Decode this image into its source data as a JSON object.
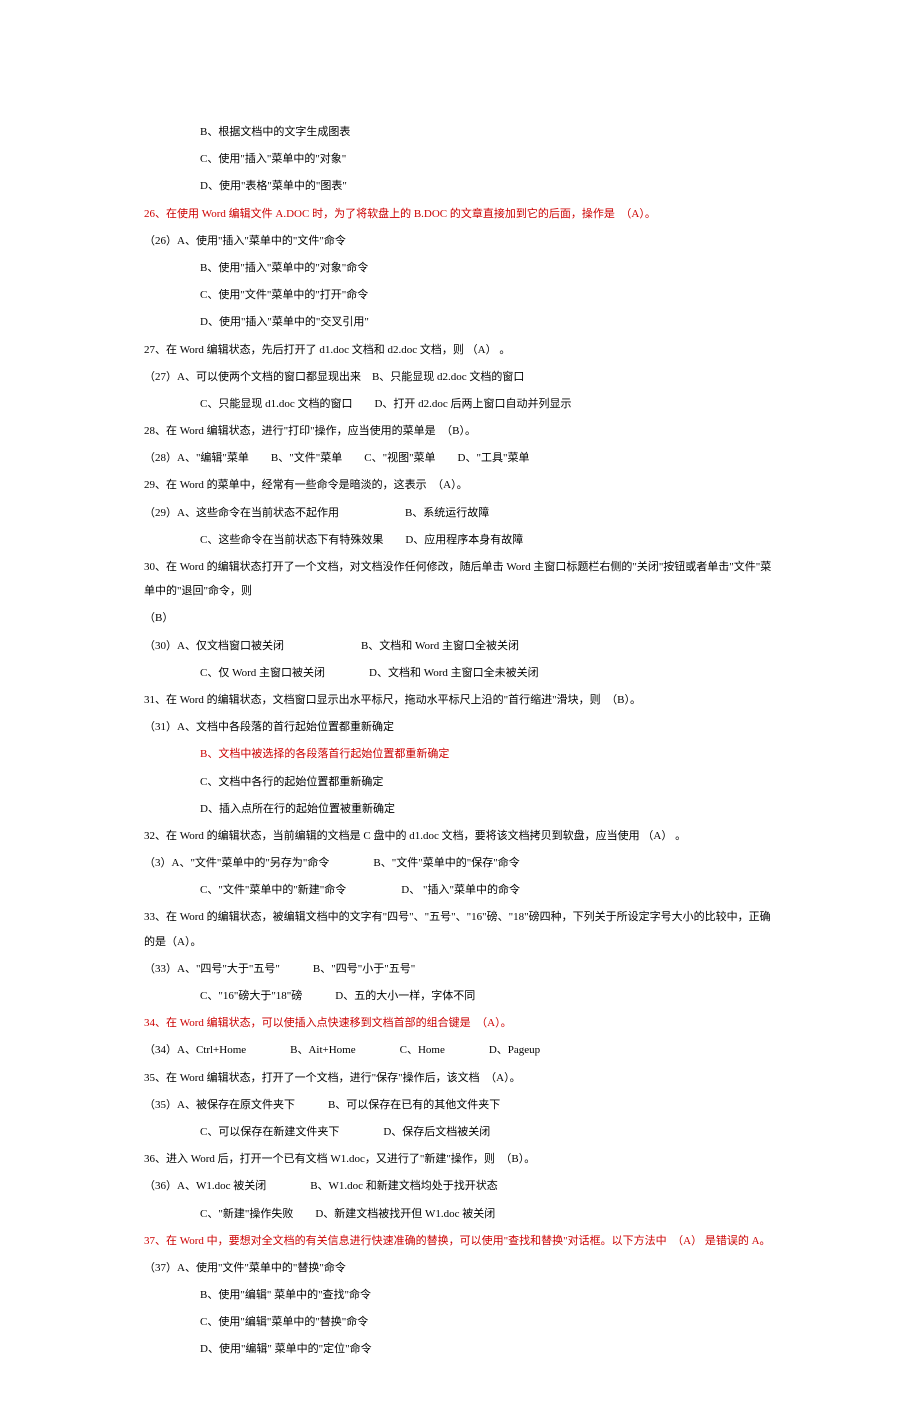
{
  "lines": [
    {
      "cls": "indent1",
      "red": false,
      "text": "B、根据文档中的文字生成图表"
    },
    {
      "cls": "indent1",
      "red": false,
      "text": "C、使用\"插入\"菜单中的\"对象\""
    },
    {
      "cls": "indent1",
      "red": false,
      "text": "D、使用\"表格\"菜单中的\"图表\""
    },
    {
      "cls": "indent0",
      "red": true,
      "text": "26、在使用 Word 编辑文件 A.DOC 时，为了将软盘上的 B.DOC 的文章直接加到它的后面，操作是　（A）。"
    },
    {
      "cls": "indent0",
      "red": false,
      "text": "（26）A、使用\"插入\"菜单中的\"文件\"命令"
    },
    {
      "cls": "indent1",
      "red": false,
      "text": "B、使用\"插入\"菜单中的\"对象\"命令"
    },
    {
      "cls": "indent1",
      "red": false,
      "text": "C、使用\"文件\"菜单中的\"打开\"命令"
    },
    {
      "cls": "indent1",
      "red": false,
      "text": "D、使用\"插入\"菜单中的\"交叉引用\""
    },
    {
      "cls": "indent0",
      "red": false,
      "text": "27、在 Word 编辑状态，先后打开了 d1.doc 文档和 d2.doc 文档，则 （A） 。"
    },
    {
      "cls": "indent0",
      "red": false,
      "text": "（27）A、可以使两个文档的窗口都显现出来　B、只能显现 d2.doc 文档的窗口"
    },
    {
      "cls": "indent1",
      "red": false,
      "text": "C、只能显现 d1.doc 文档的窗口　　D、打开 d2.doc 后两上窗口自动并列显示"
    },
    {
      "cls": "indent0",
      "red": false,
      "text": "28、在 Word 编辑状态，进行\"打印\"操作，应当使用的菜单是　（B）。"
    },
    {
      "cls": "indent0",
      "red": false,
      "text": "（28）A、\"编辑\"菜单　　B、\"文件\"菜单　　C、\"视图\"菜单　　D、\"工具\"菜单"
    },
    {
      "cls": "indent0",
      "red": false,
      "text": "29、在 Word 的菜单中，经常有一些命令是暗淡的，这表示　（A）。"
    },
    {
      "cls": "indent0",
      "red": false,
      "text": "（29）A、这些命令在当前状态不起作用　　　　　　B、系统运行故障"
    },
    {
      "cls": "indent1",
      "red": false,
      "text": "C、这些命令在当前状态下有特殊效果　　D、应用程序本身有故障"
    },
    {
      "cls": "indent0",
      "red": false,
      "text": "30、在 Word 的编辑状态打开了一个文档，对文档没作任何修改，随后单击 Word 主窗口标题栏右侧的\"关闭\"按钮或者单击\"文件\"菜单中的\"退回\"命令，则"
    },
    {
      "cls": "indent0",
      "red": false,
      "text": "（B）"
    },
    {
      "cls": "indent0",
      "red": false,
      "text": "（30）A、仅文档窗口被关闭　　　　　　　B、文档和 Word 主窗口全被关闭"
    },
    {
      "cls": "indent1",
      "red": false,
      "text": "C、仅 Word 主窗口被关闭　　　　D、文档和 Word 主窗口全未被关闭"
    },
    {
      "cls": "indent0",
      "red": false,
      "text": "31、在 Word 的编辑状态，文档窗口显示出水平标尺，拖动水平标尺上沿的\"首行缩进\"滑块，则　（B）。"
    },
    {
      "cls": "indent0",
      "red": false,
      "text": "（31）A、文档中各段落的首行起始位置都重新确定"
    },
    {
      "cls": "indent1",
      "red": true,
      "text": "B、文档中被选择的各段落首行起始位置都重新确定"
    },
    {
      "cls": "indent1",
      "red": false,
      "text": "C、文档中各行的起始位置都重新确定"
    },
    {
      "cls": "indent1",
      "red": false,
      "text": "D、插入点所在行的起始位置被重新确定"
    },
    {
      "cls": "indent0",
      "red": false,
      "text": "32、在 Word 的编辑状态，当前编辑的文档是 C 盘中的 d1.doc 文档，要将该文档拷贝到软盘，应当使用 （A） 。"
    },
    {
      "cls": "indent0",
      "red": false,
      "text": "（3）A、\"文件\"菜单中的\"另存为\"命令　　　　B、\"文件\"菜单中的\"保存\"命令"
    },
    {
      "cls": "indent1",
      "red": false,
      "text": "C、\"文件\"菜单中的\"新建\"命令　　　　　D、 \"插入\"菜单中的命令"
    },
    {
      "cls": "indent0",
      "red": false,
      "text": "33、在 Word 的编辑状态，被编辑文档中的文字有\"四号\"、\"五号\"、\"16\"磅、\"18\"磅四种，下列关于所设定字号大小的比较中，正确的是（A）。"
    },
    {
      "cls": "indent0",
      "red": false,
      "text": "（33）A、\"四号\"大于\"五号\"　　　B、\"四号\"小于\"五号\""
    },
    {
      "cls": "indent1",
      "red": false,
      "text": "C、\"16\"磅大于\"18\"磅　　　D、五的大小一样，字体不同"
    },
    {
      "cls": "indent0",
      "red": true,
      "text": "34、在 Word 编辑状态，可以使插入点快速移到文档首部的组合键是　（A）。"
    },
    {
      "cls": "indent0",
      "red": false,
      "text": "（34）A、Ctrl+Home　　　　B、Ait+Home　　　　C、Home　　　　D、Pageup"
    },
    {
      "cls": "indent0",
      "red": false,
      "text": "35、在 Word 编辑状态，打开了一个文档，进行\"保存\"操作后，该文档　（A）。"
    },
    {
      "cls": "indent0",
      "red": false,
      "text": "（35）A、被保存在原文件夹下　　　B、可以保存在已有的其他文件夹下"
    },
    {
      "cls": "indent1",
      "red": false,
      "text": "C、可以保存在新建文件夹下　　　　D、保存后文档被关闭"
    },
    {
      "cls": "indent0",
      "red": false,
      "text": "36、进入 Word 后，打开一个已有文档 W1.doc，又进行了\"新建\"操作，则　（B）。"
    },
    {
      "cls": "indent0",
      "red": false,
      "text": "（36）A、W1.doc 被关闭　　　　B、W1.doc 和新建文档均处于找开状态"
    },
    {
      "cls": "indent1",
      "red": false,
      "text": "C、\"新建\"操作失败　　D、新建文档被找开但 W1.doc 被关闭"
    },
    {
      "cls": "indent0",
      "red": true,
      "text": "37、在 Word 中，要想对全文档的有关信息进行快速准确的替换，可以使用\"查找和替换\"对话框。以下方法中　（A） 是错误的 A。"
    },
    {
      "cls": "indent0",
      "red": false,
      "text": "（37）A、使用\"文件\"菜单中的\"替换\"命令"
    },
    {
      "cls": "indent1",
      "red": false,
      "text": "B、使用\"编辑\" 菜单中的\"查找\"命令"
    },
    {
      "cls": "indent1",
      "red": false,
      "text": "C、使用\"编辑\"菜单中的\"替换\"命令"
    },
    {
      "cls": "indent1",
      "red": false,
      "text": "D、使用\"编辑\" 菜单中的\"定位\"命令"
    }
  ]
}
